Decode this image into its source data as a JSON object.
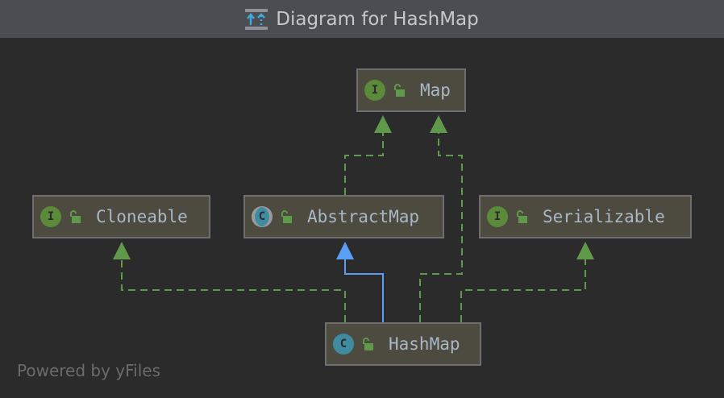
{
  "window": {
    "title": "Diagram for HashMap",
    "icon": "diagram-icon"
  },
  "nodes": {
    "map": {
      "label": "Map",
      "kind": "I"
    },
    "cloneable": {
      "label": "Cloneable",
      "kind": "I"
    },
    "abstractmap": {
      "label": "AbstractMap",
      "kind": "C"
    },
    "serializable": {
      "label": "Serializable",
      "kind": "I"
    },
    "hashmap": {
      "label": "HashMap",
      "kind": "C"
    }
  },
  "colors": {
    "implements": "#5f9a4a",
    "extends": "#5a9ef5",
    "background": "#2b2b2b"
  },
  "footer": {
    "powered_by": "Powered by yFiles"
  }
}
